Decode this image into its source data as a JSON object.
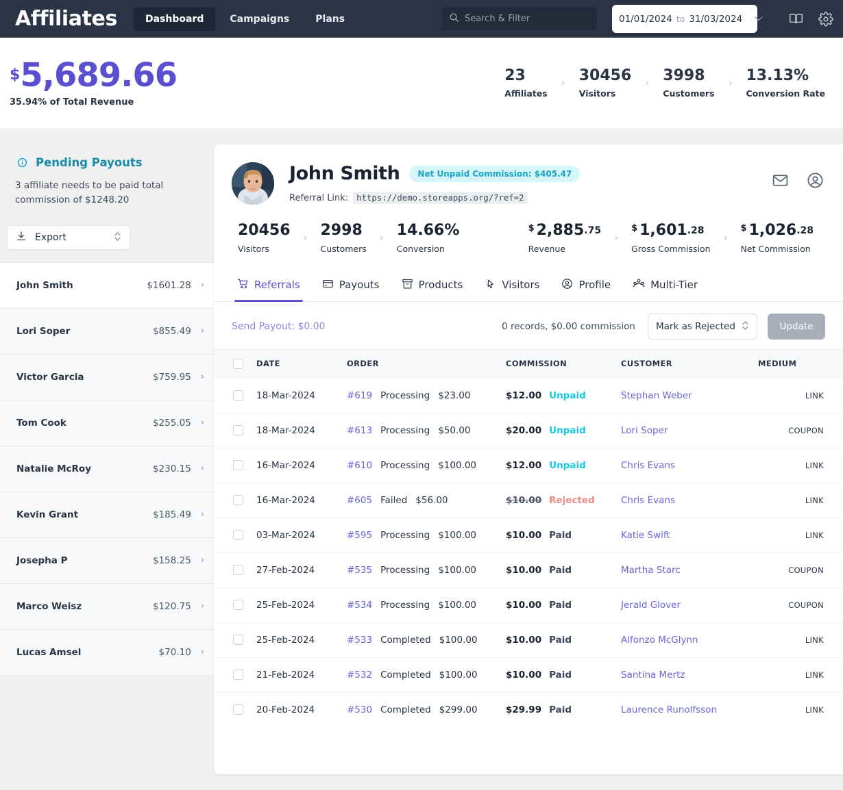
{
  "topnav": {
    "brand": "Affiliates",
    "links": [
      {
        "label": "Dashboard",
        "active": true
      },
      {
        "label": "Campaigns",
        "active": false
      },
      {
        "label": "Plans",
        "active": false
      }
    ],
    "search_placeholder": "Search & Filter",
    "search_value": "",
    "date_from": "01/01/2024",
    "date_to_label": "to",
    "date_to": "31/03/2024",
    "icons": [
      "book-icon",
      "gear-icon"
    ],
    "bg_color": "#2b3445"
  },
  "summary": {
    "currency": "$",
    "total": "5,689.66",
    "subtitle": "35.94% of Total Revenue",
    "accent_color": "#5a4fcf",
    "kpis": [
      {
        "value": "23",
        "label": "Affiliates"
      },
      {
        "value": "30456",
        "label": "Visitors"
      },
      {
        "value": "3998",
        "label": "Customers"
      },
      {
        "value": "13.13%",
        "label": "Conversion Rate"
      }
    ]
  },
  "sidebar": {
    "pending_title": "Pending Payouts",
    "pending_icon": "info-icon",
    "pending_desc": "3 affiliate needs to be paid total commission of $1248.20",
    "export_label": "Export",
    "export_icon": "download-icon",
    "affiliates": [
      {
        "name": "John Smith",
        "amount": "$1601.28",
        "selected": true
      },
      {
        "name": "Lori Soper",
        "amount": "$855.49",
        "selected": false
      },
      {
        "name": "Victor Garcia",
        "amount": "$759.95",
        "selected": false
      },
      {
        "name": "Tom Cook",
        "amount": "$255.05",
        "selected": false
      },
      {
        "name": "Natalie McRoy",
        "amount": "$230.15",
        "selected": false
      },
      {
        "name": "Kevin Grant",
        "amount": "$185.49",
        "selected": false
      },
      {
        "name": "Josepha P",
        "amount": "$158.25",
        "selected": false
      },
      {
        "name": "Marco Weisz",
        "amount": "$120.75",
        "selected": false
      },
      {
        "name": "Lucas Amsel",
        "amount": "$70.10",
        "selected": false
      }
    ]
  },
  "profile": {
    "name": "John Smith",
    "badge": "Net Unpaid Commission: $405.47",
    "badge_color": "#1aa5c4",
    "badge_bg": "#d6f5fb",
    "referral_label": "Referral Link:",
    "referral_link": "https://demo.storeapps.org/?ref=2",
    "avatar_name": "avatar",
    "actions": [
      "mail-icon",
      "user-circle-icon"
    ],
    "stats_left": [
      {
        "value": "20456",
        "label": "Visitors"
      },
      {
        "value": "2998",
        "label": "Customers"
      },
      {
        "value": "14.66%",
        "label": "Conversion"
      }
    ],
    "stats_right": [
      {
        "currency": "$",
        "value": "2,885",
        "dec": ".75",
        "label": "Revenue"
      },
      {
        "currency": "$",
        "value": "1,601",
        "dec": ".28",
        "label": "Gross Commission"
      },
      {
        "currency": "$",
        "value": "1,026",
        "dec": ".28",
        "label": "Net Commission"
      }
    ]
  },
  "tabs": [
    {
      "label": "Referrals",
      "icon": "cart-icon",
      "active": true
    },
    {
      "label": "Payouts",
      "icon": "card-icon",
      "active": false
    },
    {
      "label": "Products",
      "icon": "box-icon",
      "active": false
    },
    {
      "label": "Visitors",
      "icon": "cursor-icon",
      "active": false
    },
    {
      "label": "Profile",
      "icon": "user-circle-icon",
      "active": false
    },
    {
      "label": "Multi-Tier",
      "icon": "group-icon",
      "active": false
    }
  ],
  "toolbar": {
    "send_payout": "Send Payout: $0.00",
    "records": "0 records, $0.00 commission",
    "select_value": "Mark as Rejected",
    "update_label": "Update"
  },
  "table": {
    "columns": [
      "DATE",
      "ORDER",
      "COMMISSION",
      "CUSTOMER",
      "MEDIUM"
    ],
    "rows": [
      {
        "date": "18-Mar-2024",
        "order_id": "#619",
        "order_status": "Processing",
        "order_amount": "$23.00",
        "commission": "$12.00",
        "status": "Unpaid",
        "status_kind": "unpaid",
        "struck": false,
        "customer": "Stephan Weber",
        "medium": "LINK"
      },
      {
        "date": "18-Mar-2024",
        "order_id": "#613",
        "order_status": "Processing",
        "order_amount": "$50.00",
        "commission": "$20.00",
        "status": "Unpaid",
        "status_kind": "unpaid",
        "struck": false,
        "customer": "Lori Soper",
        "medium": "COUPON"
      },
      {
        "date": "16-Mar-2024",
        "order_id": "#610",
        "order_status": "Processing",
        "order_amount": "$100.00",
        "commission": "$12.00",
        "status": "Unpaid",
        "status_kind": "unpaid",
        "struck": false,
        "customer": "Chris Evans",
        "medium": "LINK"
      },
      {
        "date": "16-Mar-2024",
        "order_id": "#605",
        "order_status": "Failed",
        "order_amount": "$56.00",
        "commission": "$10.00",
        "status": "Rejected",
        "status_kind": "rejected",
        "struck": true,
        "customer": "Chris Evans",
        "medium": "LINK"
      },
      {
        "date": "03-Mar-2024",
        "order_id": "#595",
        "order_status": "Processing",
        "order_amount": "$100.00",
        "commission": "$10.00",
        "status": "Paid",
        "status_kind": "paid",
        "struck": false,
        "customer": "Katie Swift",
        "medium": "LINK"
      },
      {
        "date": "27-Feb-2024",
        "order_id": "#535",
        "order_status": "Processing",
        "order_amount": "$100.00",
        "commission": "$10.00",
        "status": "Paid",
        "status_kind": "paid",
        "struck": false,
        "customer": "Martha Starc",
        "medium": "COUPON"
      },
      {
        "date": "25-Feb-2024",
        "order_id": "#534",
        "order_status": "Processing",
        "order_amount": "$100.00",
        "commission": "$10.00",
        "status": "Paid",
        "status_kind": "paid",
        "struck": false,
        "customer": "Jerald Glover",
        "medium": "COUPON"
      },
      {
        "date": "25-Feb-2024",
        "order_id": "#533",
        "order_status": "Completed",
        "order_amount": "$100.00",
        "commission": "$10.00",
        "status": "Paid",
        "status_kind": "paid",
        "struck": false,
        "customer": "Alfonzo McGlynn",
        "medium": "LINK"
      },
      {
        "date": "21-Feb-2024",
        "order_id": "#532",
        "order_status": "Completed",
        "order_amount": "$100.00",
        "commission": "$10.00",
        "status": "Paid",
        "status_kind": "paid",
        "struck": false,
        "customer": "Santina Mertz",
        "medium": "LINK"
      },
      {
        "date": "20-Feb-2024",
        "order_id": "#530",
        "order_status": "Completed",
        "order_amount": "$299.00",
        "commission": "$29.99",
        "status": "Paid",
        "status_kind": "paid",
        "struck": false,
        "customer": "Laurence Runolfsson",
        "medium": "LINK"
      }
    ]
  }
}
